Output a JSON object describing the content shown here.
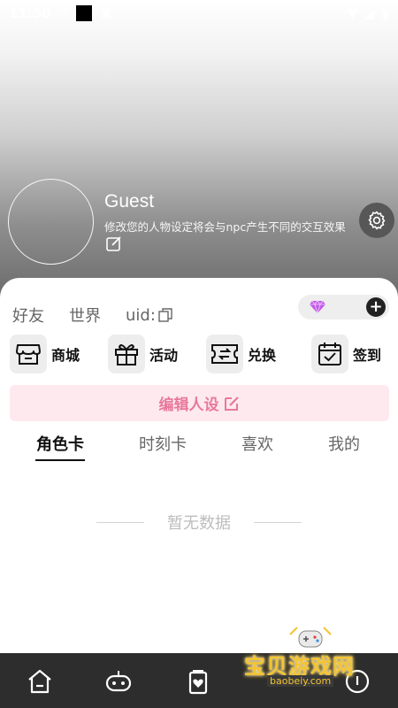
{
  "status_bar": {
    "time": "11:50",
    "icons": [
      "download-icon",
      "image-icon",
      "wifi-icon",
      "signal-icon",
      "battery-icon"
    ]
  },
  "profile": {
    "name": "Guest",
    "description": "修改您的人物设定将会与npc产生不同的交互效果"
  },
  "nav_tabs": {
    "friends": "好友",
    "world": "世界",
    "uid_label": "uid:"
  },
  "actions": [
    {
      "label": "商城",
      "icon": "shop-icon"
    },
    {
      "label": "活动",
      "icon": "gift-icon"
    },
    {
      "label": "兑换",
      "icon": "ticket-exchange-icon"
    },
    {
      "label": "签到",
      "icon": "calendar-check-icon"
    }
  ],
  "edit_persona_label": "编辑人设",
  "content_tabs": [
    "角色卡",
    "时刻卡",
    "喜欢",
    "我的"
  ],
  "active_content_tab": "角色卡",
  "empty_text": "暂无数据",
  "watermark": {
    "title": "宝贝游戏网",
    "url": "baobeiy.com"
  },
  "colors": {
    "accent_pink": "#e8799a",
    "accent_bg": "#fde9ee",
    "bottom_bar": "#2d2d2d",
    "gem": "#b84de0"
  }
}
